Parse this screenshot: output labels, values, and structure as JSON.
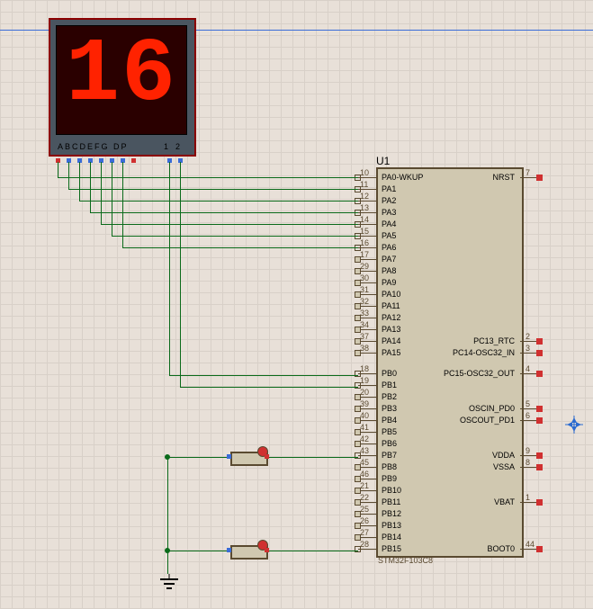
{
  "display": {
    "value": "16",
    "segment_labels": "ABCDEFG DP",
    "digit_labels": "12",
    "pin_markers_count": 9
  },
  "chip": {
    "ref": "U1",
    "part": "STM32F103C8",
    "left_pins": [
      {
        "num": "10",
        "name": "PA0-WKUP"
      },
      {
        "num": "11",
        "name": "PA1"
      },
      {
        "num": "12",
        "name": "PA2"
      },
      {
        "num": "13",
        "name": "PA3"
      },
      {
        "num": "14",
        "name": "PA4"
      },
      {
        "num": "15",
        "name": "PA5"
      },
      {
        "num": "16",
        "name": "PA6"
      },
      {
        "num": "17",
        "name": "PA7"
      },
      {
        "num": "29",
        "name": "PA8"
      },
      {
        "num": "30",
        "name": "PA9"
      },
      {
        "num": "31",
        "name": "PA10"
      },
      {
        "num": "32",
        "name": "PA11"
      },
      {
        "num": "33",
        "name": "PA12"
      },
      {
        "num": "34",
        "name": "PA13"
      },
      {
        "num": "37",
        "name": "PA14"
      },
      {
        "num": "38",
        "name": "PA15"
      },
      {
        "num": "18",
        "name": "PB0"
      },
      {
        "num": "19",
        "name": "PB1"
      },
      {
        "num": "20",
        "name": "PB2"
      },
      {
        "num": "39",
        "name": "PB3"
      },
      {
        "num": "40",
        "name": "PB4"
      },
      {
        "num": "41",
        "name": "PB5"
      },
      {
        "num": "42",
        "name": "PB6"
      },
      {
        "num": "43",
        "name": "PB7"
      },
      {
        "num": "45",
        "name": "PB8"
      },
      {
        "num": "46",
        "name": "PB9"
      },
      {
        "num": "21",
        "name": "PB10"
      },
      {
        "num": "22",
        "name": "PB11"
      },
      {
        "num": "25",
        "name": "PB12"
      },
      {
        "num": "26",
        "name": "PB13"
      },
      {
        "num": "27",
        "name": "PB14"
      },
      {
        "num": "28",
        "name": "PB15"
      }
    ],
    "right_pins": [
      {
        "num": "7",
        "name": "NRST",
        "row": 0
      },
      {
        "num": "2",
        "name": "PC13_RTC",
        "row": 14
      },
      {
        "num": "3",
        "name": "PC14-OSC32_IN",
        "row": 15
      },
      {
        "num": "4",
        "name": "PC15-OSC32_OUT",
        "row": 16
      },
      {
        "num": "5",
        "name": "OSCIN_PD0",
        "row": 19
      },
      {
        "num": "6",
        "name": "OSCOUT_PD1",
        "row": 20
      },
      {
        "num": "9",
        "name": "VDDA",
        "row": 23
      },
      {
        "num": "8",
        "name": "VSSA",
        "row": 24
      },
      {
        "num": "1",
        "name": "VBAT",
        "row": 27
      },
      {
        "num": "44",
        "name": "BOOT0",
        "row": 31
      }
    ]
  },
  "chart_data": {
    "type": "schematic",
    "display_value": 16,
    "connections": [
      {
        "from": "display.A",
        "to": "U1.PA0"
      },
      {
        "from": "display.B",
        "to": "U1.PA1"
      },
      {
        "from": "display.C",
        "to": "U1.PA2"
      },
      {
        "from": "display.D",
        "to": "U1.PA3"
      },
      {
        "from": "display.E",
        "to": "U1.PA4"
      },
      {
        "from": "display.F",
        "to": "U1.PA5"
      },
      {
        "from": "display.G",
        "to": "U1.PA6"
      },
      {
        "from": "display.1",
        "to": "U1.PB0"
      },
      {
        "from": "display.2",
        "to": "U1.PB1"
      },
      {
        "from": "button1",
        "to": "U1.PB7"
      },
      {
        "from": "button2",
        "to": "U1.PB15"
      },
      {
        "from": "button1",
        "to": "GND"
      },
      {
        "from": "button2",
        "to": "GND"
      }
    ]
  }
}
